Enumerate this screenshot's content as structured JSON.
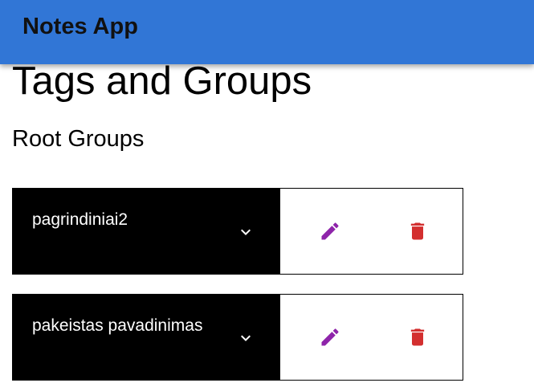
{
  "app": {
    "title": "Notes App"
  },
  "page": {
    "title": "Tags and Groups",
    "section_title": "Root Groups"
  },
  "groups": [
    {
      "name": "pagrindiniai2",
      "expand_icon": "chevron-down-icon",
      "edit_icon": "pencil-icon",
      "delete_icon": "trash-icon"
    },
    {
      "name": "pakeistas pavadinimas",
      "expand_icon": "chevron-down-icon",
      "edit_icon": "pencil-icon",
      "delete_icon": "trash-icon"
    }
  ],
  "colors": {
    "appbar": "#3176d6",
    "edit": "#8e24aa",
    "delete": "#d32f2f",
    "group_background": "#000000"
  }
}
